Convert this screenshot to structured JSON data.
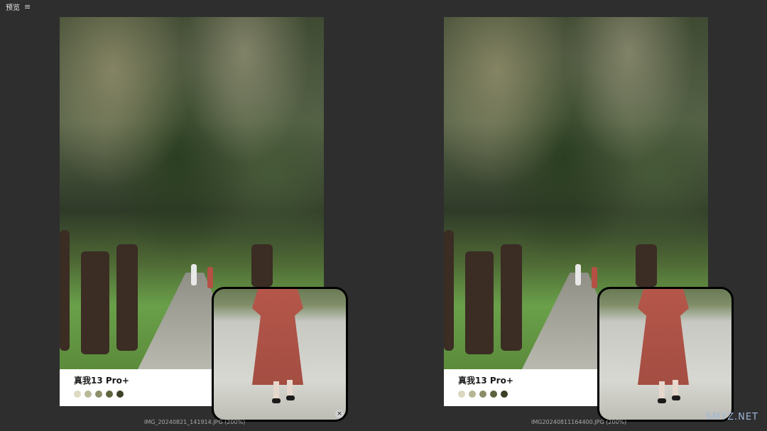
{
  "app": {
    "title": "预览",
    "menu_icon": "≡"
  },
  "panels": [
    {
      "caption": {
        "model": "真我13 Pro+",
        "swatch_colors": [
          "#dedac2",
          "#b9b99a",
          "#8c8f6a",
          "#5f653f",
          "#3e4229"
        ]
      },
      "filename": "IMG_20240821_141914.JPG (200%)",
      "close_icon": "×"
    },
    {
      "caption": {
        "model": "真我13 Pro+",
        "swatch_colors": [
          "#dcd8c0",
          "#b6b696",
          "#8a8d67",
          "#5c623d",
          "#3b3f27"
        ]
      },
      "filename": "IMG20240811164400.JPG (200%)"
    }
  ],
  "watermark": "SMYZ.NET"
}
